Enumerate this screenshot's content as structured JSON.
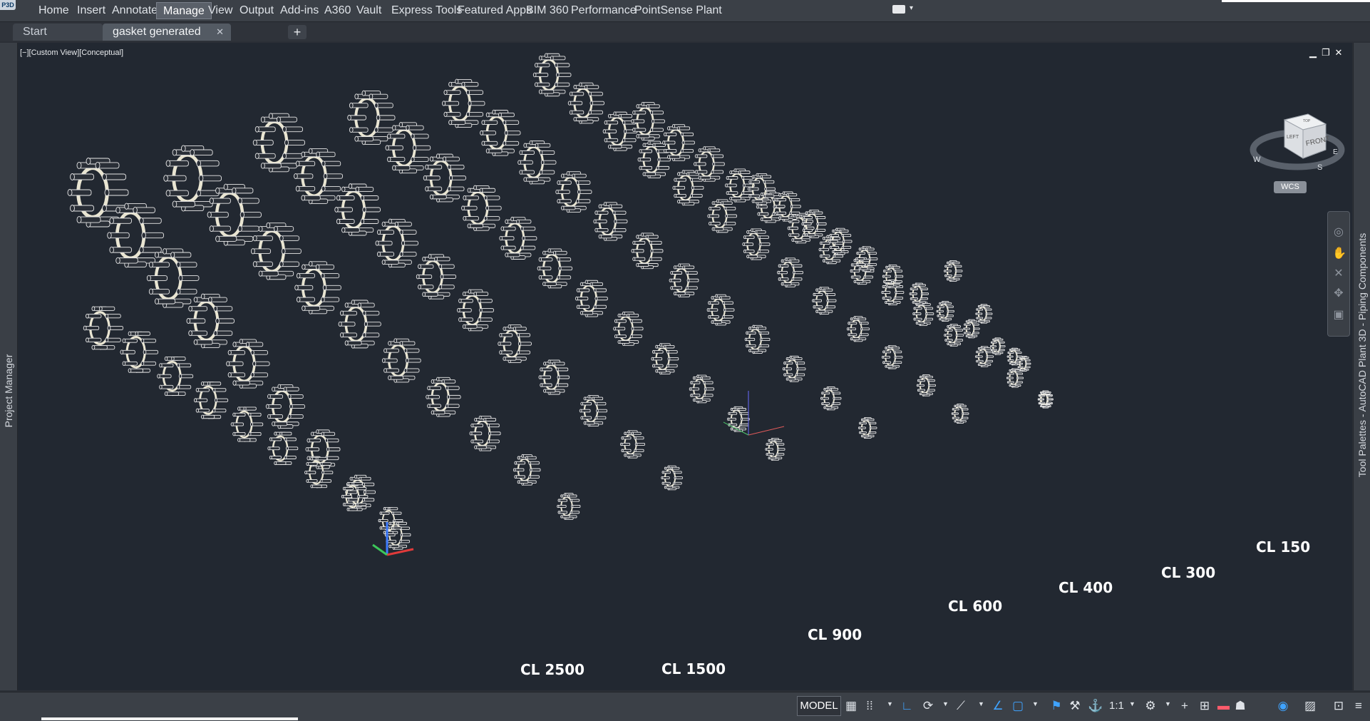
{
  "app": {
    "badge": "P3D"
  },
  "ribbon": {
    "tabs": [
      {
        "label": "Home",
        "active": false
      },
      {
        "label": "Insert",
        "active": false
      },
      {
        "label": "Annotate",
        "active": false
      },
      {
        "label": "Manage",
        "active": true
      },
      {
        "label": "View",
        "active": false
      },
      {
        "label": "Output",
        "active": false
      },
      {
        "label": "Add-ins",
        "active": false
      },
      {
        "label": "A360",
        "active": false
      },
      {
        "label": "Vault",
        "active": false
      },
      {
        "label": "Express Tools",
        "active": false
      },
      {
        "label": "Featured Apps",
        "active": false
      },
      {
        "label": "BIM 360",
        "active": false
      },
      {
        "label": "Performance",
        "active": false
      },
      {
        "label": "PointSense Plant",
        "active": false
      }
    ]
  },
  "document_tabs": {
    "tabs": [
      {
        "label": "Start",
        "active": false
      },
      {
        "label": "gasket generated blocks*",
        "active": true
      }
    ],
    "close_glyph": "✕",
    "new_tab_glyph": "+"
  },
  "left_palette": {
    "title": "Project Manager"
  },
  "right_palette": {
    "title": "Tool Palettes - AutoCAD Plant 3D - Piping Components"
  },
  "viewport": {
    "label": "[−][Custom View][Conceptual]",
    "controls": {
      "minimize": "▁",
      "restore": "❐",
      "close": "✕"
    },
    "class_labels": [
      "CL 2500",
      "CL 1500",
      "CL 900",
      "CL 600",
      "CL 400",
      "CL 300",
      "CL 150"
    ]
  },
  "viewcube": {
    "top": "TOP",
    "front": "FRONT",
    "left": "LEFT",
    "compass": {
      "w": "W",
      "s": "S",
      "e": "E"
    },
    "wcs_label": "WCS"
  },
  "statusbar": {
    "model_label": "MODEL",
    "scale_label": "1:1"
  },
  "colors": {
    "viewport_bg": "#222831",
    "bolt_stroke": "#e8e8e8",
    "gasket_fill": "#e9e5d2",
    "ucs_red": "#e03a3a",
    "ucs_green": "#3cc75a",
    "ucs_blue": "#3d7bff",
    "active_blue": "#3fa3ff"
  }
}
